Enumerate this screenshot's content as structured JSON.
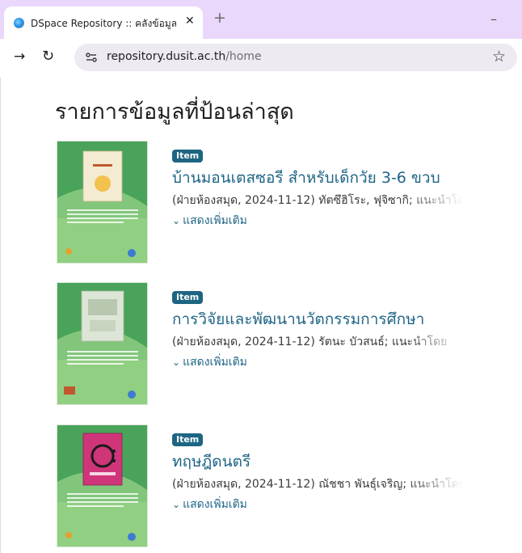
{
  "browser": {
    "tab": {
      "title": "DSpace Repository :: คลังข้อมูลดิจิทัล",
      "close_icon": "close-icon"
    },
    "new_tab_label": "+",
    "minimize_label": "–",
    "url_host": "repository.dusit.ac.th",
    "url_path": "/home",
    "icons": [
      "forward-arrow-icon",
      "reload-icon",
      "site-settings-icon",
      "bookmark-star-icon"
    ]
  },
  "page": {
    "heading": "รายการข้อมูลที่ป้อนล่าสุด",
    "items": [
      {
        "badge": "Item",
        "title": "บ้านมอนเตสซอรี สำหรับเด็กวัย 3-6 ขวบ",
        "meta": "(ฝ่ายห้องสมุด, 2024-11-12) ทัตซึฮิโระ, ฟุจิซากิ; แนะนำโดย",
        "more": "แสดงเพิ่มเติม",
        "cover_color": "#f3ecd2"
      },
      {
        "badge": "Item",
        "title": "การวิจัยและพัฒนานวัตกรรมการศึกษา",
        "meta": "(ฝ่ายห้องสมุด, 2024-11-12) รัตนะ บัวสนธ์; แนะนำโดย",
        "more": "แสดงเพิ่มเติม",
        "cover_color": "#dde6d6"
      },
      {
        "badge": "Item",
        "title": "ทฤษฎีดนตรี",
        "meta": "(ฝ่ายห้องสมุด, 2024-11-12) ณัชชา พันธุ์เจริญ; แนะนำโดย",
        "more": "แสดงเพิ่มเติม",
        "cover_color": "#d0357a"
      }
    ]
  },
  "colors": {
    "tabbar": "#e9d8fb",
    "link": "#1f6586",
    "badge": "#1e6582",
    "thumb_green": "#4aa35a"
  }
}
